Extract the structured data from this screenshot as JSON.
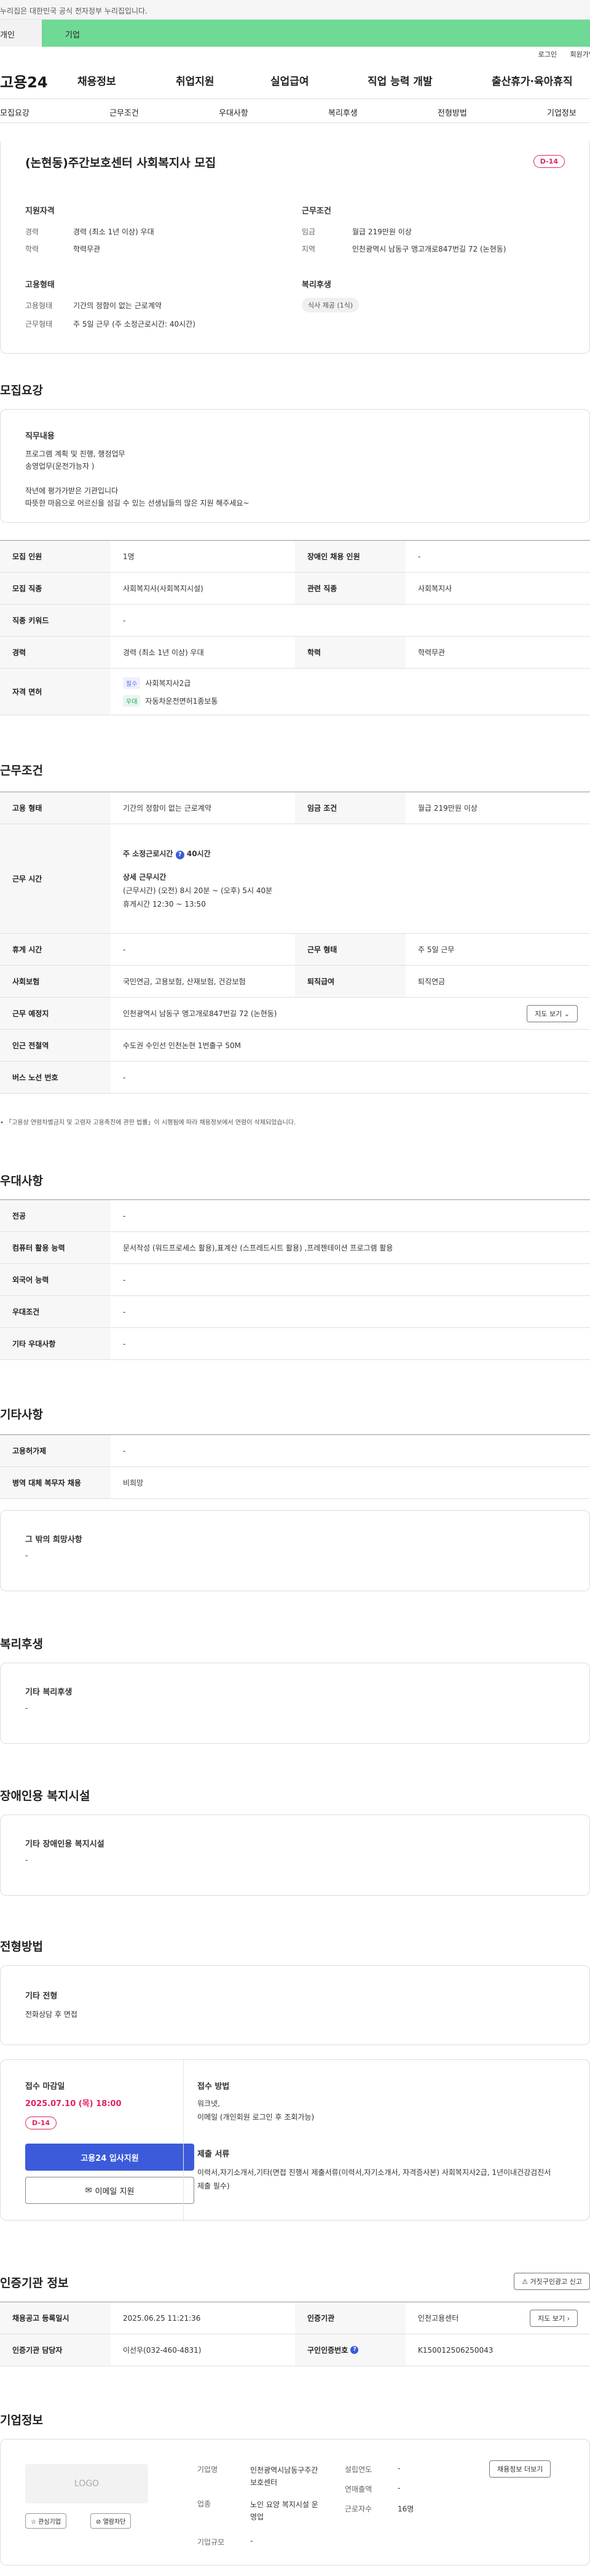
{
  "gov_banner": "이 누리집은 대한민국 공식 전자정부 누리집입니다.",
  "gov_banner_visible": "누리집은 대한민국 공식 전자정부 누리집입니다.",
  "tabs": {
    "personal": "개인",
    "enterprise": "기업"
  },
  "util": {
    "login": "로그인",
    "join": "회원가입"
  },
  "logo": "고용24",
  "gnb": [
    "채용정보",
    "취업지원",
    "실업급여",
    "직업 능력 개발",
    "출산휴가·육아휴직"
  ],
  "subnav": [
    "모집요강",
    "근무조건",
    "우대사항",
    "복리후생",
    "전형방법",
    "기업정보"
  ],
  "summary": {
    "title": "(논현동)주간보호센터 사회복지사 모집",
    "dday": "D-14",
    "qual_heading": "지원자격",
    "career_label": "경력",
    "career_value": "경력 (최소 1년 이상) 우대",
    "edu_label": "학력",
    "edu_value": "학력무관",
    "work_heading": "근무조건",
    "wage_label": "임금",
    "wage_value": "월급 219만원 이상",
    "region_label": "지역",
    "region_value": "인천광역시 남동구 앵고개로847번길 72 (논현동)",
    "emp_heading": "고용형태",
    "emptype_label": "고용형태",
    "emptype_value": "기간의 정함이 없는 근로계약",
    "worktype_label": "근무형태",
    "worktype_value": "주 5일 근무 (주 소정근로시간: 40시간)",
    "welfare_heading": "복리후생",
    "welfare_chip": "식사 제공 (1식)"
  },
  "recruit": {
    "heading": "모집요강",
    "job_heading": "직무내용",
    "job_lines": [
      "프로그램 계획 및 진행, 행정업무",
      "송영업무(운전가능자 )",
      "",
      "작년에 평가가받은 기관입니다",
      "따뜻한 마음으로 어르신을 섬길 수 있는 선생님들의 많은 지원 해주세요~"
    ],
    "count_label": "모집 인원",
    "count_value": "1명",
    "disabled_label": "장애인 채용 인원",
    "disabled_value": "-",
    "occ_label": "모집 직종",
    "occ_value": "사회복지사(사회복지시설)",
    "related_label": "관련 직종",
    "related_value": "사회복지사",
    "keyword_label": "직종 키워드",
    "keyword_value": "-",
    "career_label": "경력",
    "career_value": "경력 (최소 1년 이상) 우대",
    "edu_label": "학력",
    "edu_value": "학력무관",
    "license_label": "자격 면허",
    "license_required_tag": "필수",
    "license_required": "사회복지사2급",
    "license_pref_tag": "우대",
    "license_pref": "자동차운전면허1종보통"
  },
  "work": {
    "heading": "근무조건",
    "emptype_label": "고용 형태",
    "emptype_value": "기간의 정함이 없는 근로계약",
    "wage_label": "임금 조건",
    "wage_value": "월급 219만원 이상",
    "hours_label": "근무 시간",
    "hours_weekly": "주 소정근로시간",
    "hours_weekly_value": "40시간",
    "hours_detail_title": "상세 근무시간",
    "hours_detail_1": "(근무시간) (오전) 8시 20분 ~ (오후) 5시 40분",
    "hours_detail_2": "휴게시간 12:30 ~ 13:50",
    "break_label": "휴게 시간",
    "break_value": "-",
    "worktype_label": "근무 형태",
    "worktype_value": "주 5일 근무",
    "insurance_label": "사회보험",
    "insurance_value": "국민연금, 고용보험, 산재보험, 건강보험",
    "retire_label": "퇴직급여",
    "retire_value": "퇴직연금",
    "place_label": "근무 예정지",
    "place_value": "인천광역시 남동구 앵고개로847번길 72 (논현동)",
    "map_btn": "지도 보기",
    "subway_label": "인근 전철역",
    "subway_value": "수도권 수인선 인천논현 1번출구 50M",
    "bus_label": "버스 노선 번호",
    "bus_value": "-",
    "notice": "「고용상 연령차별금지 및 고령자 고용촉진에 관한 법률」이 시행됨에 따라 채용정보에서 연령이 삭제되었습니다."
  },
  "pref": {
    "heading": "우대사항",
    "major_label": "전공",
    "major_value": "-",
    "computer_label": "컴퓨터 활용 능력",
    "computer_value": "문서작성 (워드프로세스 활용),표계산 (스프레드시트 활용) ,프레젠테이션 프로그램 활용",
    "lang_label": "외국어 능력",
    "lang_value": "-",
    "cond_label": "우대조건",
    "cond_value": "-",
    "etc_label": "기타 우대사항",
    "etc_value": "-"
  },
  "other": {
    "heading": "기타사항",
    "permit_label": "고용허가제",
    "permit_value": "-",
    "military_label": "병역 대체 복무자 채용",
    "military_value": "비희망",
    "wish_heading": "그 밖의 희망사항",
    "wish_value": "-"
  },
  "welfare": {
    "heading": "복리후생",
    "sub": "기타 복리후생",
    "value": "-"
  },
  "facility": {
    "heading": "장애인용 복지시설",
    "sub": "기타 장애인용 복지시설",
    "value": "-"
  },
  "selection": {
    "heading": "전형방법",
    "sub": "기타 전형",
    "value": "전화상담 후 면접",
    "deadline_label": "접수 마감일",
    "deadline_value": "2025.07.10 (목) 18:00",
    "dday": "D-14",
    "apply_btn": "고용24 입사지원",
    "email_btn": "이메일 지원",
    "method_label": "접수 방법",
    "method_1": "워크넷,",
    "method_2": "이메일 (개인회원 로그인 후 조회가능)",
    "docs_label": "제출 서류",
    "docs_value": "이력서,자기소개서,기타(면접 진행시 제출서류(이력서,자기소개서, 자격증사본) 사회복지사2급, 1년이내건강검진서 제출 필수)"
  },
  "cert": {
    "heading": "인증기관 정보",
    "report_btn": "거짓구인광고 신고",
    "reg_label": "채용공고 등록일시",
    "reg_value": "2025.06.25 11:21:36",
    "org_label": "인증기관",
    "org_value": "인천고용센터",
    "map_btn": "지도 보기",
    "manager_label": "인증기관 담당자",
    "manager_value": "이선우(032-460-4831)",
    "num_label": "구인인증번호",
    "num_value": "K150012506250043"
  },
  "company": {
    "heading": "기업정보",
    "logo_text": "LOGO",
    "fav_btn": "관심기업",
    "hide_btn": "열람차단",
    "name_label": "기업명",
    "name_value": "인천광역시남동구주간보호센터",
    "founded_label": "설립연도",
    "founded_value": "-",
    "sales_label": "연매출액",
    "sales_value": "-",
    "industry_label": "업종",
    "industry_value": "노인 요양 복지시설 운영업",
    "staff_label": "근로자수",
    "staff_value": "16명",
    "size_label": "기업규모",
    "size_value": "-",
    "jobs_btn": "채용정보 더보기"
  }
}
